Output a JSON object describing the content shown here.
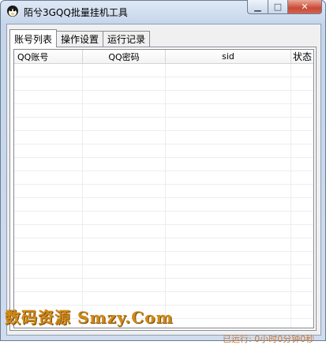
{
  "window": {
    "title": "陌兮3GQQ批量挂机工具",
    "minimize_glyph": "▁",
    "maximize_glyph": "□",
    "close_glyph": "✕"
  },
  "tabs": [
    {
      "label": "账号列表",
      "active": true
    },
    {
      "label": "操作设置",
      "active": false
    },
    {
      "label": "运行记录",
      "active": false
    }
  ],
  "table": {
    "columns": [
      "QQ账号",
      "QQ密码",
      "sid",
      "状态"
    ],
    "rows": []
  },
  "watermark": "数码资源 Smzy.Com",
  "status_text": "已运行: 0小时0分钟0秒"
}
